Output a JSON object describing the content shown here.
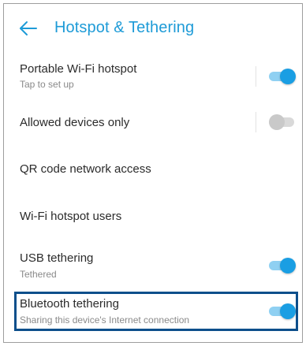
{
  "header": {
    "back_icon": "arrow-left-icon",
    "title": "Hotspot & Tethering"
  },
  "colors": {
    "accent": "#1e9bd7",
    "toggle_on": "#1a9ee3",
    "highlight_border": "#0d4f8b"
  },
  "settings": [
    {
      "label": "Portable Wi-Fi hotspot",
      "sublabel": "Tap to set up",
      "toggle": true,
      "has_divider": true
    },
    {
      "label": "Allowed devices only",
      "sublabel": "",
      "toggle": false,
      "has_divider": true
    },
    {
      "label": "QR code network access",
      "sublabel": ""
    },
    {
      "label": "Wi-Fi hotspot users",
      "sublabel": ""
    },
    {
      "label": "USB tethering",
      "sublabel": "Tethered",
      "toggle": true,
      "has_divider": false
    },
    {
      "label": "Bluetooth tethering",
      "sublabel": "Sharing this device's Internet connection",
      "toggle": true,
      "has_divider": false,
      "highlighted": true
    }
  ]
}
